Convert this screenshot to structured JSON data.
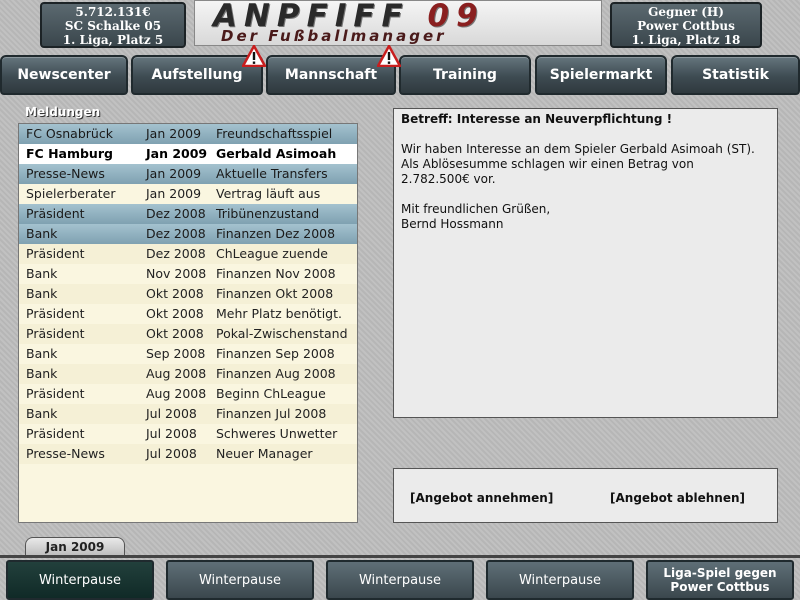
{
  "header": {
    "left": {
      "money": "5.712.131€",
      "club": "SC Schalke 05",
      "league": "1. Liga, Platz 5"
    },
    "right": {
      "opponent_label": "Gegner (H)",
      "opponent": "Power Cottbus",
      "league": "1. Liga, Platz 18"
    },
    "logo": {
      "title_prefix": "ANPFIFF ",
      "title_num": "09",
      "subtitle": "Der Fußballmanager"
    }
  },
  "nav": {
    "tabs": [
      "Newscenter",
      "Aufstellung",
      "Mannschaft",
      "Training",
      "Spielermarkt",
      "Statistik"
    ],
    "warnings": [
      "warning-icon",
      "warning-icon"
    ]
  },
  "messages": {
    "heading": "Meldungen",
    "rows": [
      {
        "sender": "FC Osnabrück",
        "date": "Jan 2009",
        "subject": "Freundschaftsspiel",
        "state": "unread"
      },
      {
        "sender": "FC Hamburg",
        "date": "Jan 2009",
        "subject": "Gerbald Asimoah",
        "state": "selected"
      },
      {
        "sender": "Presse-News",
        "date": "Jan 2009",
        "subject": "Aktuelle Transfers",
        "state": "unread"
      },
      {
        "sender": "Spielerberater",
        "date": "Jan 2009",
        "subject": "Vertrag läuft aus",
        "state": "read"
      },
      {
        "sender": "Präsident",
        "date": "Dez 2008",
        "subject": "Tribünenzustand",
        "state": "unread"
      },
      {
        "sender": "Bank",
        "date": "Dez 2008",
        "subject": "Finanzen Dez 2008",
        "state": "unread"
      },
      {
        "sender": "Präsident",
        "date": "Dez 2008",
        "subject": "ChLeague zuende",
        "state": "read"
      },
      {
        "sender": "Bank",
        "date": "Nov 2008",
        "subject": "Finanzen Nov 2008",
        "state": "read"
      },
      {
        "sender": "Bank",
        "date": "Okt 2008",
        "subject": "Finanzen Okt 2008",
        "state": "read"
      },
      {
        "sender": "Präsident",
        "date": "Okt 2008",
        "subject": "Mehr Platz benötigt.",
        "state": "read"
      },
      {
        "sender": "Präsident",
        "date": "Okt 2008",
        "subject": "Pokal-Zwischenstand",
        "state": "read"
      },
      {
        "sender": "Bank",
        "date": "Sep 2008",
        "subject": "Finanzen Sep 2008",
        "state": "read"
      },
      {
        "sender": "Bank",
        "date": "Aug 2008",
        "subject": "Finanzen Aug 2008",
        "state": "read"
      },
      {
        "sender": "Präsident",
        "date": "Aug 2008",
        "subject": "Beginn ChLeague",
        "state": "read"
      },
      {
        "sender": "Bank",
        "date": "Jul 2008",
        "subject": "Finanzen Jul 2008",
        "state": "read"
      },
      {
        "sender": "Präsident",
        "date": "Jul 2008",
        "subject": "Schweres Unwetter",
        "state": "read"
      },
      {
        "sender": "Presse-News",
        "date": "Jul 2008",
        "subject": "Neuer Manager",
        "state": "read"
      }
    ],
    "date_tab": "Jan 2009"
  },
  "message": {
    "subject": "Betreff: Interesse an Neuverpflichtung !",
    "body_lines": [
      "Wir haben Interesse an dem Spieler Gerbald Asimoah (ST).",
      "Als Ablösesumme schlagen wir einen Betrag von",
      "2.782.500€ vor."
    ],
    "greeting": "Mit freundlichen Grüßen,",
    "signature": "Bernd Hossmann"
  },
  "actions": {
    "accept": "[Angebot annehmen]",
    "decline": "[Angebot ablehnen]"
  },
  "weeks": [
    {
      "label": "Winterpause",
      "active": true
    },
    {
      "label": "Winterpause",
      "active": false
    },
    {
      "label": "Winterpause",
      "active": false
    },
    {
      "label": "Winterpause",
      "active": false
    },
    {
      "label_lines": [
        "Liga-Spiel gegen",
        "Power Cottbus"
      ],
      "active": false
    }
  ],
  "colors": {
    "unread_row": "#8fb0bf",
    "list_bg": "#faf6e0",
    "panel_bg": "#ebebeb",
    "nav_bg": "#3e4b52",
    "active_week": "#102a27"
  }
}
